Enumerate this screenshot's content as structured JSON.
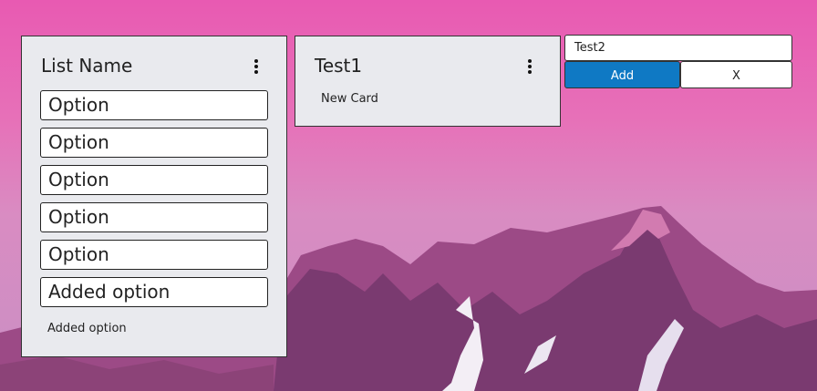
{
  "lists": [
    {
      "title": "List Name",
      "options": [
        "Option",
        "Option",
        "Option",
        "Option",
        "Option",
        "Added option"
      ],
      "cards": [
        "Added option"
      ]
    },
    {
      "title": "Test1",
      "options": [],
      "cards": [
        "New Card"
      ]
    }
  ],
  "new_list_form": {
    "input_value": "Test2",
    "add_label": "Add",
    "close_label": "X"
  },
  "colors": {
    "add_button": "#0f79c4",
    "panel": "#e9eaee",
    "sky_top": "#e85ab2"
  }
}
